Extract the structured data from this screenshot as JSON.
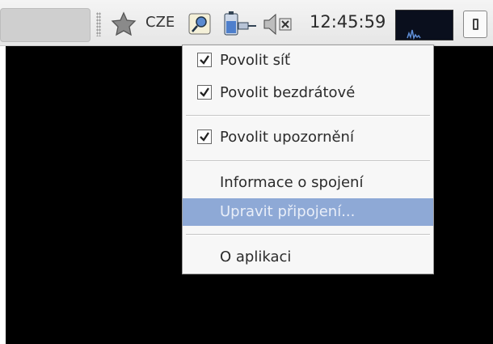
{
  "panel": {
    "keyboard_layout": "CZE",
    "clock": "12:45:59",
    "icons": [
      "favorites-icon",
      "network-manager-icon",
      "battery-power-icon",
      "volume-muted-icon",
      "system-monitor-icon",
      "battery-applet-icon"
    ]
  },
  "menu": {
    "items": [
      {
        "label": "Povolit síť",
        "checked": true
      },
      {
        "label": "Povolit bezdrátové",
        "checked": true
      },
      {
        "label": "Povolit upozornění",
        "checked": true
      },
      {
        "label": "Informace o spojení"
      },
      {
        "label": "Upravit připojení...",
        "highlighted": true
      },
      {
        "label": "O aplikaci"
      }
    ]
  },
  "colors": {
    "highlight": "#8ea9d6",
    "screen": "#000000",
    "panel": "#eeeeee"
  }
}
